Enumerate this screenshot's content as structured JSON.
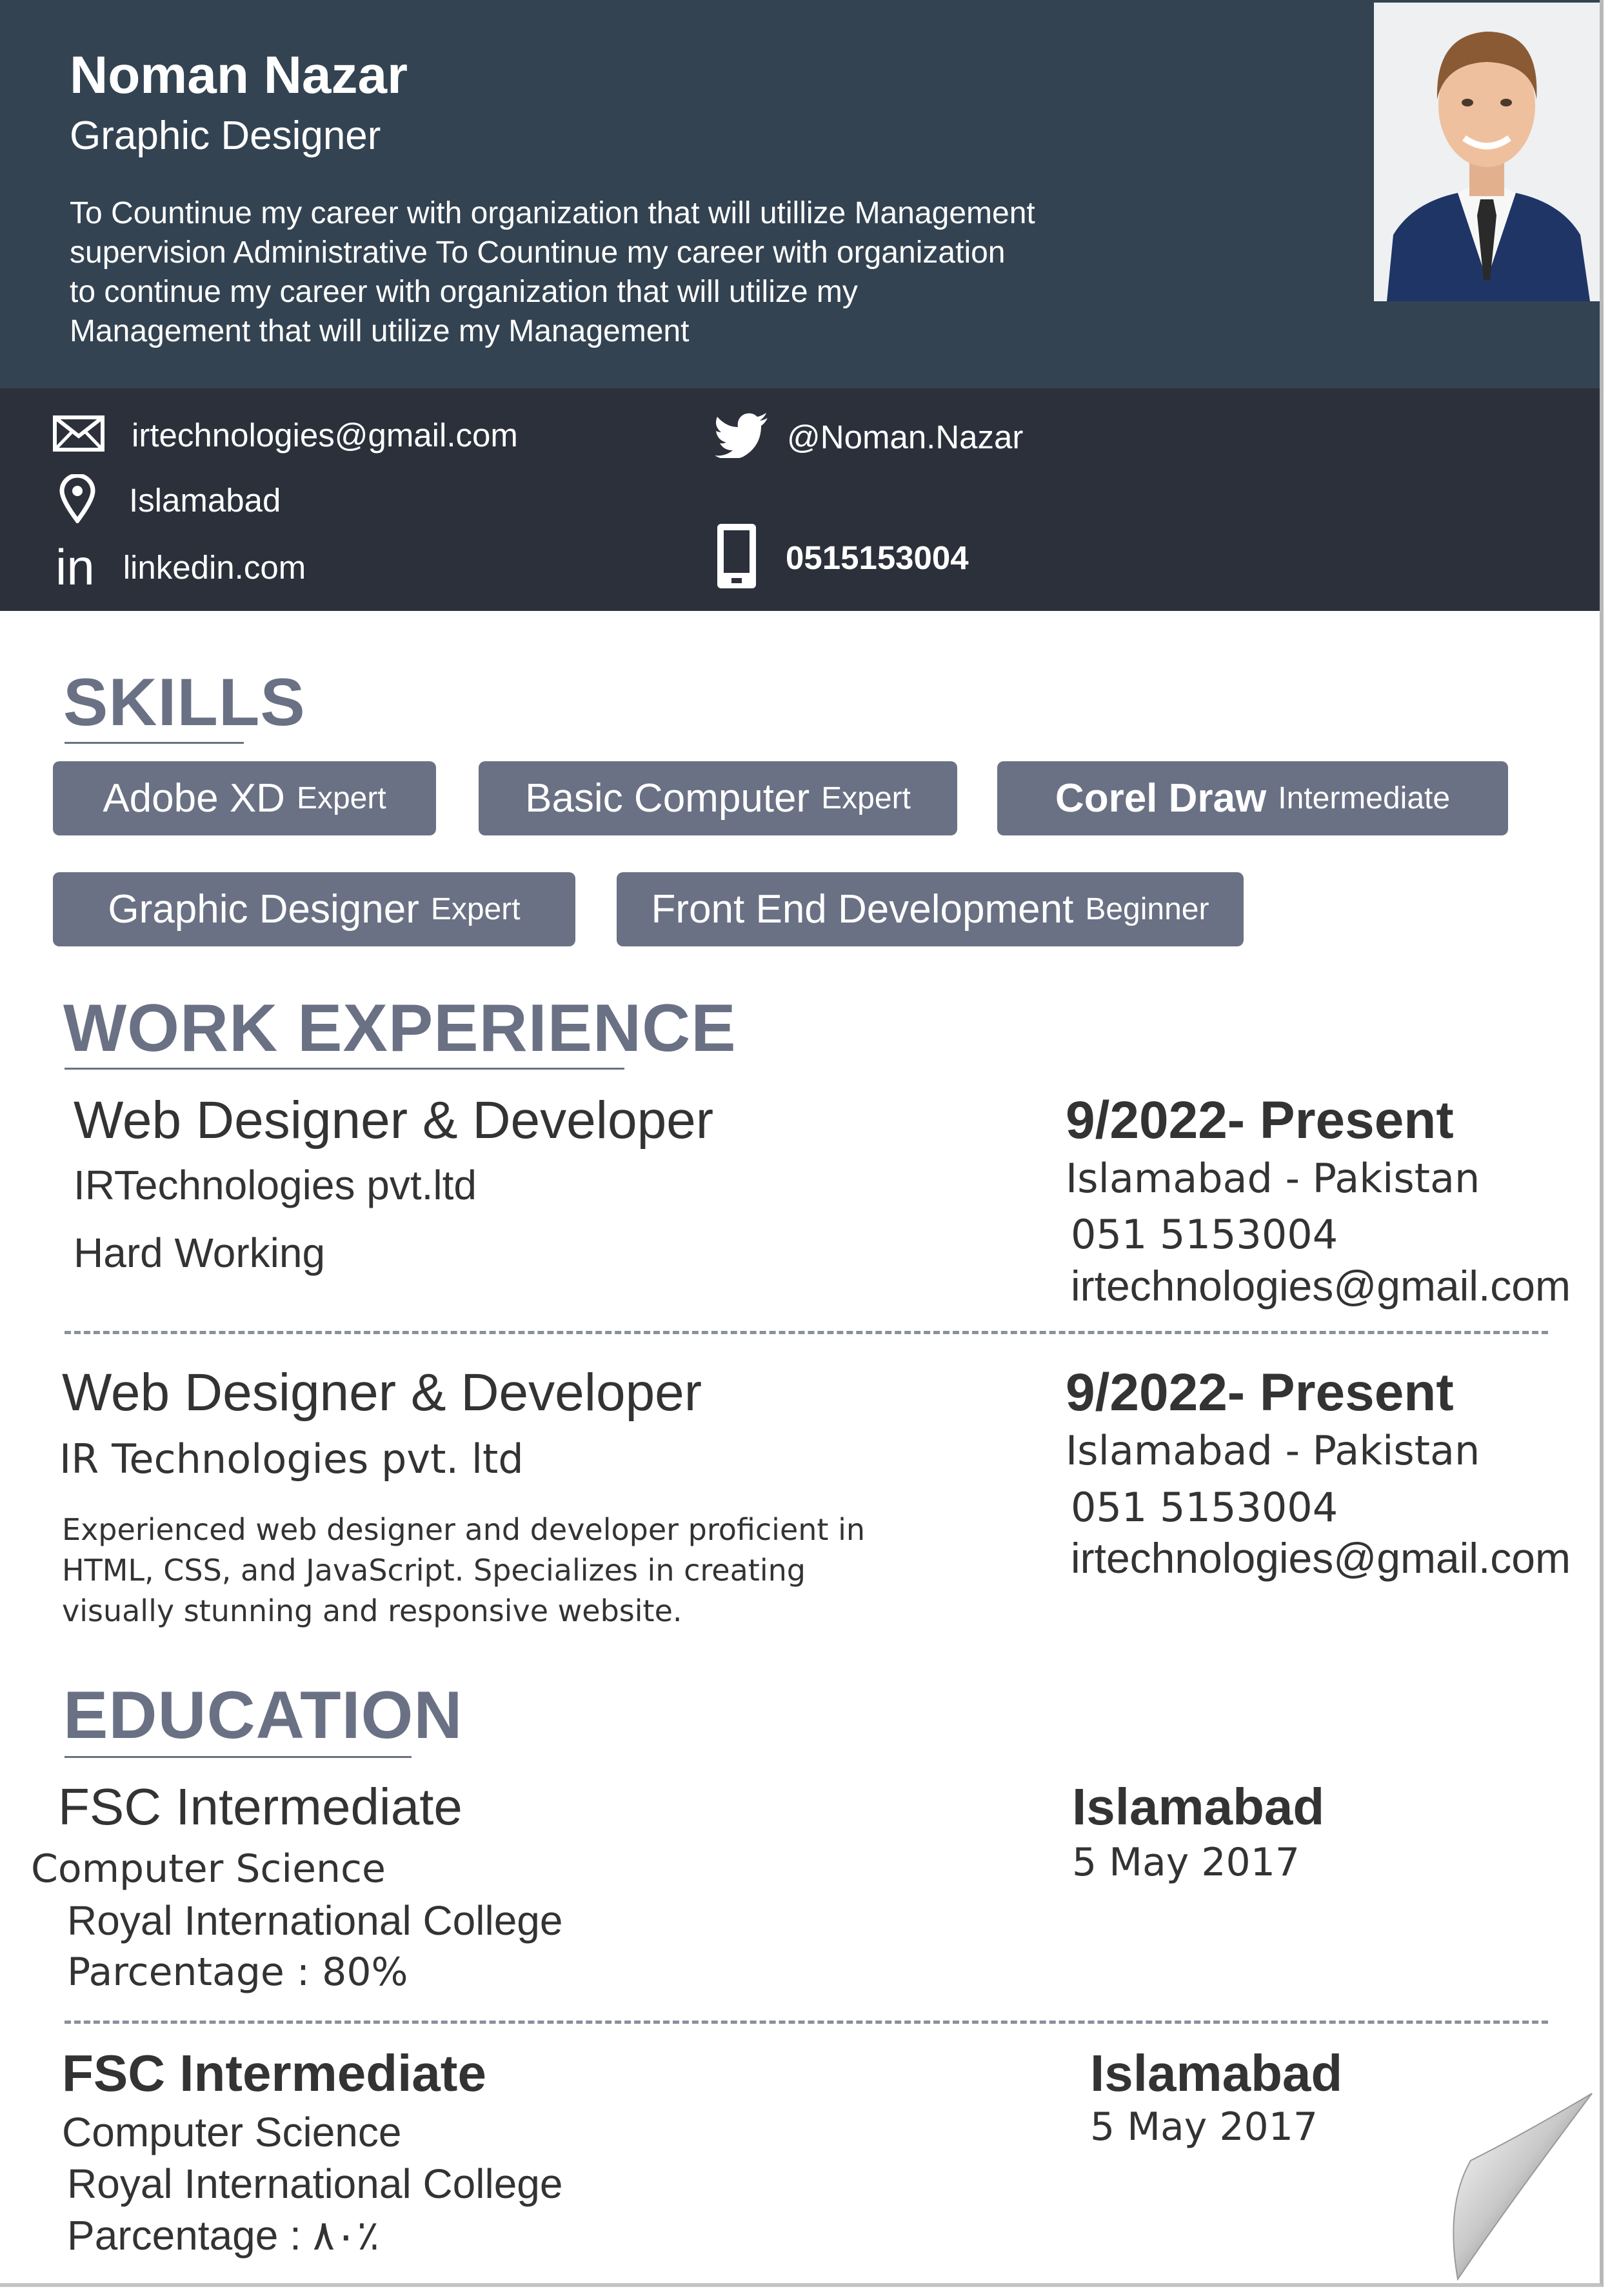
{
  "header": {
    "name": "Noman Nazar",
    "title": "Graphic Designer",
    "summary": "To Countinue my career with organization that will utillize Management supervision Administrative To Countinue my career with organization to continue my career with organization that will utilize my Management that will utilize my Management"
  },
  "contact": {
    "email": "irtechnologies@gmail.com",
    "location": "Islamabad",
    "linkedin": "linkedin.com",
    "twitter": "@Noman.Nazar",
    "phone": "0515153004",
    "icons": [
      "mail-icon",
      "location-pin-icon",
      "linkedin-icon",
      "twitter-icon",
      "mobile-phone-icon"
    ]
  },
  "skills": {
    "heading": "SKILLS",
    "items": [
      {
        "name": "Adobe XD",
        "level": "Expert"
      },
      {
        "name": "Basic Computer",
        "level": "Expert"
      },
      {
        "name": "Corel Draw",
        "level": "Intermediate"
      },
      {
        "name": "Graphic Designer",
        "level": "Expert"
      },
      {
        "name": "Front  End Development",
        "level": "Beginner"
      }
    ]
  },
  "experience": {
    "heading": "WORK EXPERIENCE",
    "items": [
      {
        "role": "Web Designer  & Developer",
        "company": "IRTechnologies pvt.ltd",
        "description": "Hard Working",
        "dates": "9/2022- Present",
        "location": "Islamabad - Pakistan",
        "phone": "051 5153004",
        "email": "irtechnologies@gmail.com"
      },
      {
        "role": "Web Designer & Developer",
        "company": "IR Technologies pvt. ltd",
        "description_lines": [
          "Experienced web designer and developer proficient in",
          "HTML, CSS, and JavaScript. Specializes in creating",
          "visually stunning and responsive website."
        ],
        "dates": "9/2022- Present",
        "location": "Islamabad - Pakistan",
        "phone": "051 5153004",
        "email": "irtechnologies@gmail.com"
      }
    ]
  },
  "education": {
    "heading": "EDUCATION",
    "items": [
      {
        "degree": "FSC Intermediate",
        "field": "Computer Science",
        "school": "Royal International College",
        "percentage": "Parcentage : 80%",
        "city": "Islamabad",
        "date": "5 May 2017"
      },
      {
        "degree": "FSC Intermediate",
        "field": "Computer Science",
        "school": "Royal International College",
        "percentage": "Parcentage : ٨٠٪",
        "city": "Islamabad",
        "date": "5 May 2017"
      }
    ]
  },
  "colors": {
    "header_bg": "#334352",
    "contact_bg": "#2b303b",
    "accent": "#6a7184"
  }
}
